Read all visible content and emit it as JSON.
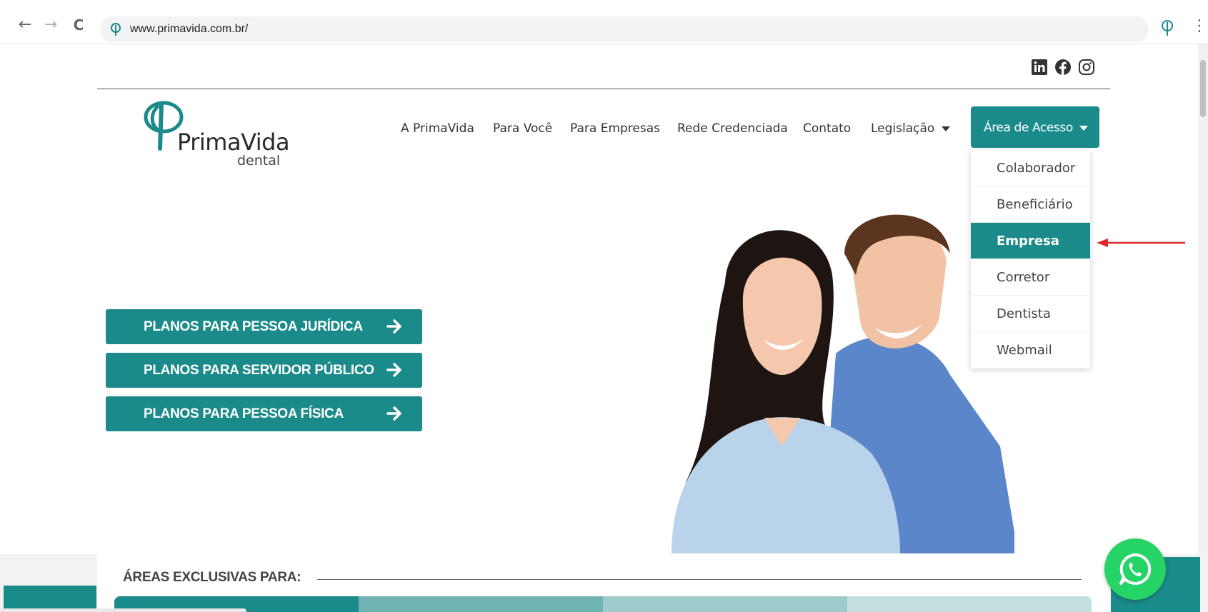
{
  "browser": {
    "url": "www.primavida.com.br/",
    "back_icon": "←",
    "forward_icon": "→",
    "reload_icon": "C",
    "menu_icon": "⋮"
  },
  "social": [
    "linkedin-icon",
    "facebook-icon",
    "instagram-icon"
  ],
  "logo": {
    "name": "PrimaVida",
    "sub": "dental"
  },
  "nav": {
    "items": [
      "A PrimaVida",
      "Para Você",
      "Para Empresas",
      "Rede Credenciada",
      "Contato",
      "Legislação"
    ],
    "access_label": "Área de Acesso"
  },
  "dropdown": {
    "items": [
      "Colaborador",
      "Beneficiário",
      "Empresa",
      "Corretor",
      "Dentista",
      "Webmail"
    ],
    "active": "Empresa"
  },
  "hero": {
    "buttons": [
      "PLANOS PARA PESSOA JURÍDICA",
      "PLANOS PARA SERVIDOR PÚBLICO",
      "PLANOS PARA PESSOA FÍSICA"
    ],
    "arrow": "➔"
  },
  "areas": {
    "title": "ÁREAS EXCLUSIVAS PARA:"
  },
  "colors": {
    "brand_teal": "#1b8a8a",
    "whatsapp_green": "#25d366",
    "annotation_red": "#e0262b"
  }
}
